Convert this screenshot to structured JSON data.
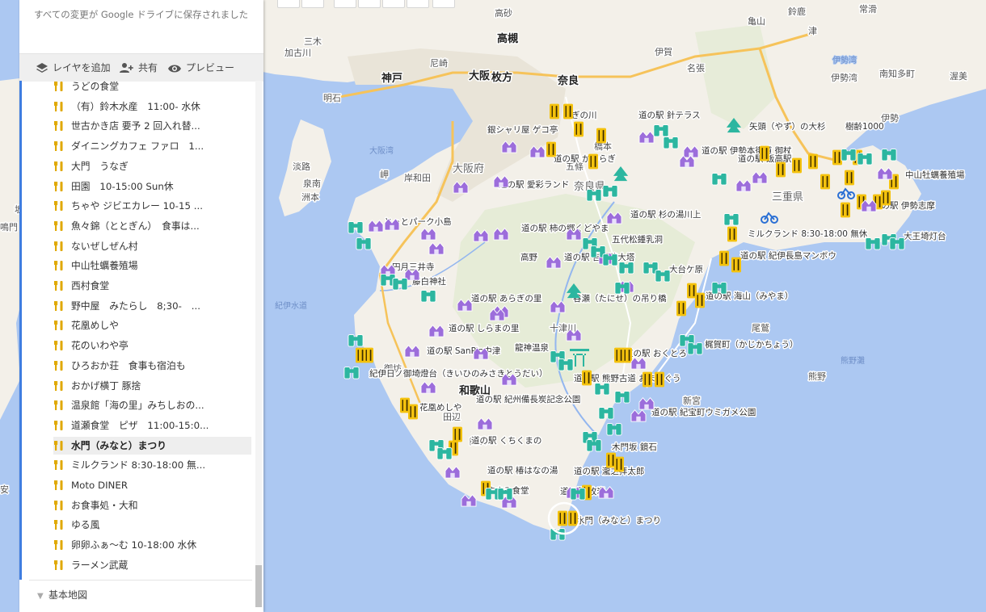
{
  "panel": {
    "save_status": "すべての変更が Google ドライブに保存されました",
    "toolbar": {
      "add_layer": "レイヤを追加",
      "share": "共有",
      "preview": "プレビュー"
    },
    "items": [
      {
        "label": "うどの食堂"
      },
      {
        "label": "（有）鈴木水産　11:00- 水休"
      },
      {
        "label": "世古かき店 要予 2 回入れ替..."
      },
      {
        "label": "ダイニングカフェ ファロ　1..."
      },
      {
        "label": "大門　うなぎ"
      },
      {
        "label": "田園　10-15:00 Sun休"
      },
      {
        "label": "ちゃや ジビエカレー 10-15 ..."
      },
      {
        "label": "魚々錦（ととぎん）　食事は..."
      },
      {
        "label": "ないぜしぜん村"
      },
      {
        "label": "中山牡蠣養殖場"
      },
      {
        "label": "西村食堂"
      },
      {
        "label": "野中屋　みたらし　8;30-　..."
      },
      {
        "label": "花凰めしや"
      },
      {
        "label": "花のいわや亭"
      },
      {
        "label": "ひろおか荘　食事も宿泊も"
      },
      {
        "label": "おかげ横丁 豚捨"
      },
      {
        "label": "温泉館「海の里」みちしおの..."
      },
      {
        "label": "道瀬食堂　ピザ　11:00-15:0..."
      },
      {
        "label": "水門（みなと）まつり",
        "selected": true
      },
      {
        "label": "ミルクランド 8:30-18:00 無..."
      },
      {
        "label": "Moto DINER"
      },
      {
        "label": "お食事処・大和"
      },
      {
        "label": "ゆる風"
      },
      {
        "label": "卵卵ふぁ～む 10-18:00 水休"
      },
      {
        "label": "ラーメン武蔵"
      }
    ],
    "basemap_label": "基本地図"
  },
  "map": {
    "pin_labels": [
      "ぎの川",
      "道の駅 針テラス",
      "銀シャリ屋 ゲコ亭",
      "道の駅 かつらぎ",
      "矢頭（やず）の大杉",
      "樹齢1000",
      "道の駅 伊勢本街道 御杖",
      "道の駅 飯高駅",
      "中山牡蠣養殖場",
      "道の駅 伊勢志摩",
      "道の駅 愛彩ランド",
      "とっとパーク小島",
      "道の駅 柿の郷くどやま",
      "道の駅 杉の湯川上",
      "五代松鍾乳洞",
      "ミルクランド 8:30-18:00 無休",
      "大王埼灯台",
      "道の駅 紀伊長島マンボウ",
      "高野",
      "道の駅 吉野路大塔",
      "大台ケ原",
      "藤白神社",
      "道の駅 あらぎの里",
      "谷瀬（たにせ）の吊り橋",
      "道の駅 海山（みやま）",
      "道の駅 しらまの里",
      "道の駅 SanPin中津",
      "龍神温泉",
      "梶賀町（かじかちょう）",
      "道の駅 おくとろ",
      "紀伊日ノ御埼燈台（きいひのみさきとうだい）",
      "道の駅 熊野古道 おまんぐう",
      "花凰めしや",
      "道の駅 紀州備長炭記念公園",
      "道の駅 紀宝町ウミガメ公園",
      "道の駅 くちくまの",
      "木門坂 鏡石",
      "道の駅 椿はなの湯",
      "道の駅 瀧之拝太郎",
      "すさみ食堂",
      "道の駅 枚岩",
      "水門（みなと）まつり",
      "円月三井寺"
    ],
    "city_labels": [
      "亀山",
      "鈴鹿",
      "津",
      "常滑",
      "南知多町",
      "渥美",
      "伊賀",
      "名張",
      "高砂",
      "加古川",
      "三木",
      "尼崎",
      "明石",
      "岸和田",
      "泉南",
      "洲本",
      "淡路",
      "坂",
      "鳴門",
      "安",
      "伊勢湾",
      "伊勢",
      "岬",
      "橋本",
      "五條",
      "御坊",
      "田辺",
      "白浜",
      "十津川",
      "新宮",
      "熊野",
      "尾鷲"
    ],
    "major_labels": [
      "神戸",
      "大阪",
      "高槻",
      "枚方",
      "奈良",
      "和歌山",
      "大阪府",
      "三重県",
      "奈良県"
    ],
    "sea_labels": [
      "大阪湾",
      "紀伊水道",
      "伊勢湾",
      "熊野灘"
    ],
    "colors": {
      "sea": "#acc8f2",
      "land": "#f3f0e9",
      "forest": "#cfe3b8",
      "urban": "#e8e3d8",
      "pin_restaurant": "#f4c20d",
      "pin_roadstation": "#9c6ddb",
      "pin_nature": "#2cb6a0",
      "highway": "#f6c35a",
      "river": "#93b6ef"
    },
    "icons": [
      "fork-knife-icon",
      "roadside-station-icon",
      "binoculars-icon",
      "tree-icon",
      "torii-icon",
      "bicycle-icon"
    ]
  }
}
